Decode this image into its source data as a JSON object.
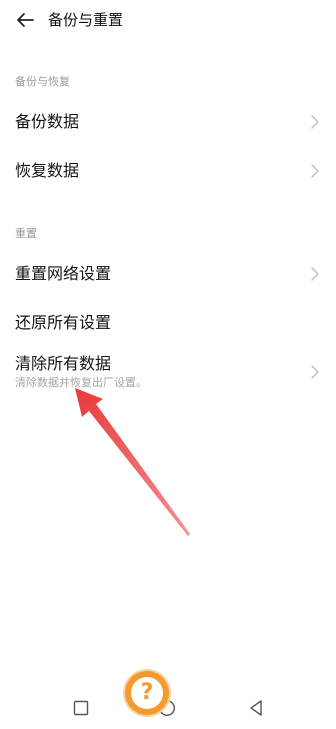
{
  "header": {
    "title": "备份与重置",
    "back_icon": "arrow-left-icon"
  },
  "sections": [
    {
      "label": "备份与恢复",
      "items": [
        {
          "label": "备份数据",
          "has_chevron": true
        },
        {
          "label": "恢复数据",
          "has_chevron": true
        }
      ]
    },
    {
      "label": "重置",
      "items": [
        {
          "label": "重置网络设置",
          "has_chevron": true
        },
        {
          "label": "还原所有设置",
          "has_chevron": false
        },
        {
          "label": "清除所有数据",
          "subtitle": "清除数据并恢复出厂设置。",
          "has_chevron": true
        }
      ]
    }
  ],
  "annotation": {
    "arrow_color": "#e8393a",
    "help_badge_symbol": "?",
    "help_badge_color": "#f49a2e"
  },
  "navbar": {
    "icons": [
      "recents-square-icon",
      "home-circle-icon",
      "back-triangle-icon"
    ]
  }
}
